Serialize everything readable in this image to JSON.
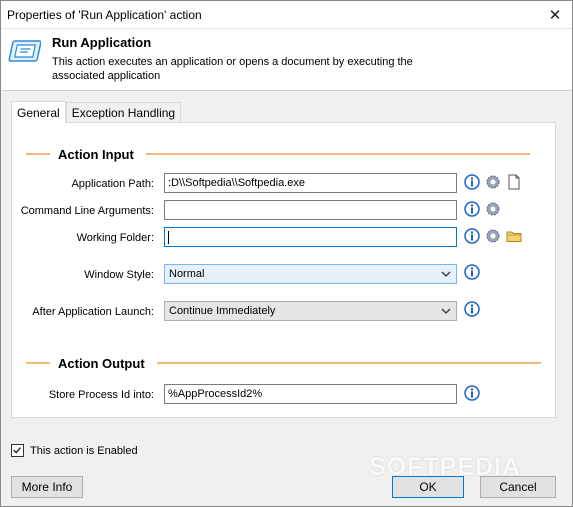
{
  "window": {
    "title": "Properties of 'Run Application' action",
    "close_glyph": "✕"
  },
  "header": {
    "title": "Run Application",
    "description": "This action executes an application or opens a document by executing the associated application",
    "icon": "run-application-icon"
  },
  "tabs": [
    {
      "label": "General",
      "active": true
    },
    {
      "label": "Exception Handling",
      "active": false
    }
  ],
  "input_section": {
    "title": "Action Input",
    "application_path": {
      "label": "Application Path:",
      "value": ":D\\\\Softpedia\\\\Softpedia.exe"
    },
    "command_line_args": {
      "label": "Command Line Arguments:",
      "value": ""
    },
    "working_folder": {
      "label": "Working Folder:",
      "value": ""
    },
    "window_style": {
      "label": "Window Style:",
      "selected": "Normal"
    },
    "after_launch": {
      "label": "After Application Launch:",
      "selected": "Continue Immediately"
    }
  },
  "output_section": {
    "title": "Action Output",
    "store_process_id": {
      "label": "Store Process Id into:",
      "value": "%AppProcessId2%"
    }
  },
  "footer": {
    "enabled_label": "This action is Enabled",
    "enabled_checked": true,
    "more_info_label": "More Info",
    "ok_label": "OK",
    "cancel_label": "Cancel"
  },
  "watermark": "SOFTPEDIA",
  "colors": {
    "section_line": "#f5b87a",
    "info_icon": "#1e64c8",
    "focus_border": "#0078d7"
  }
}
